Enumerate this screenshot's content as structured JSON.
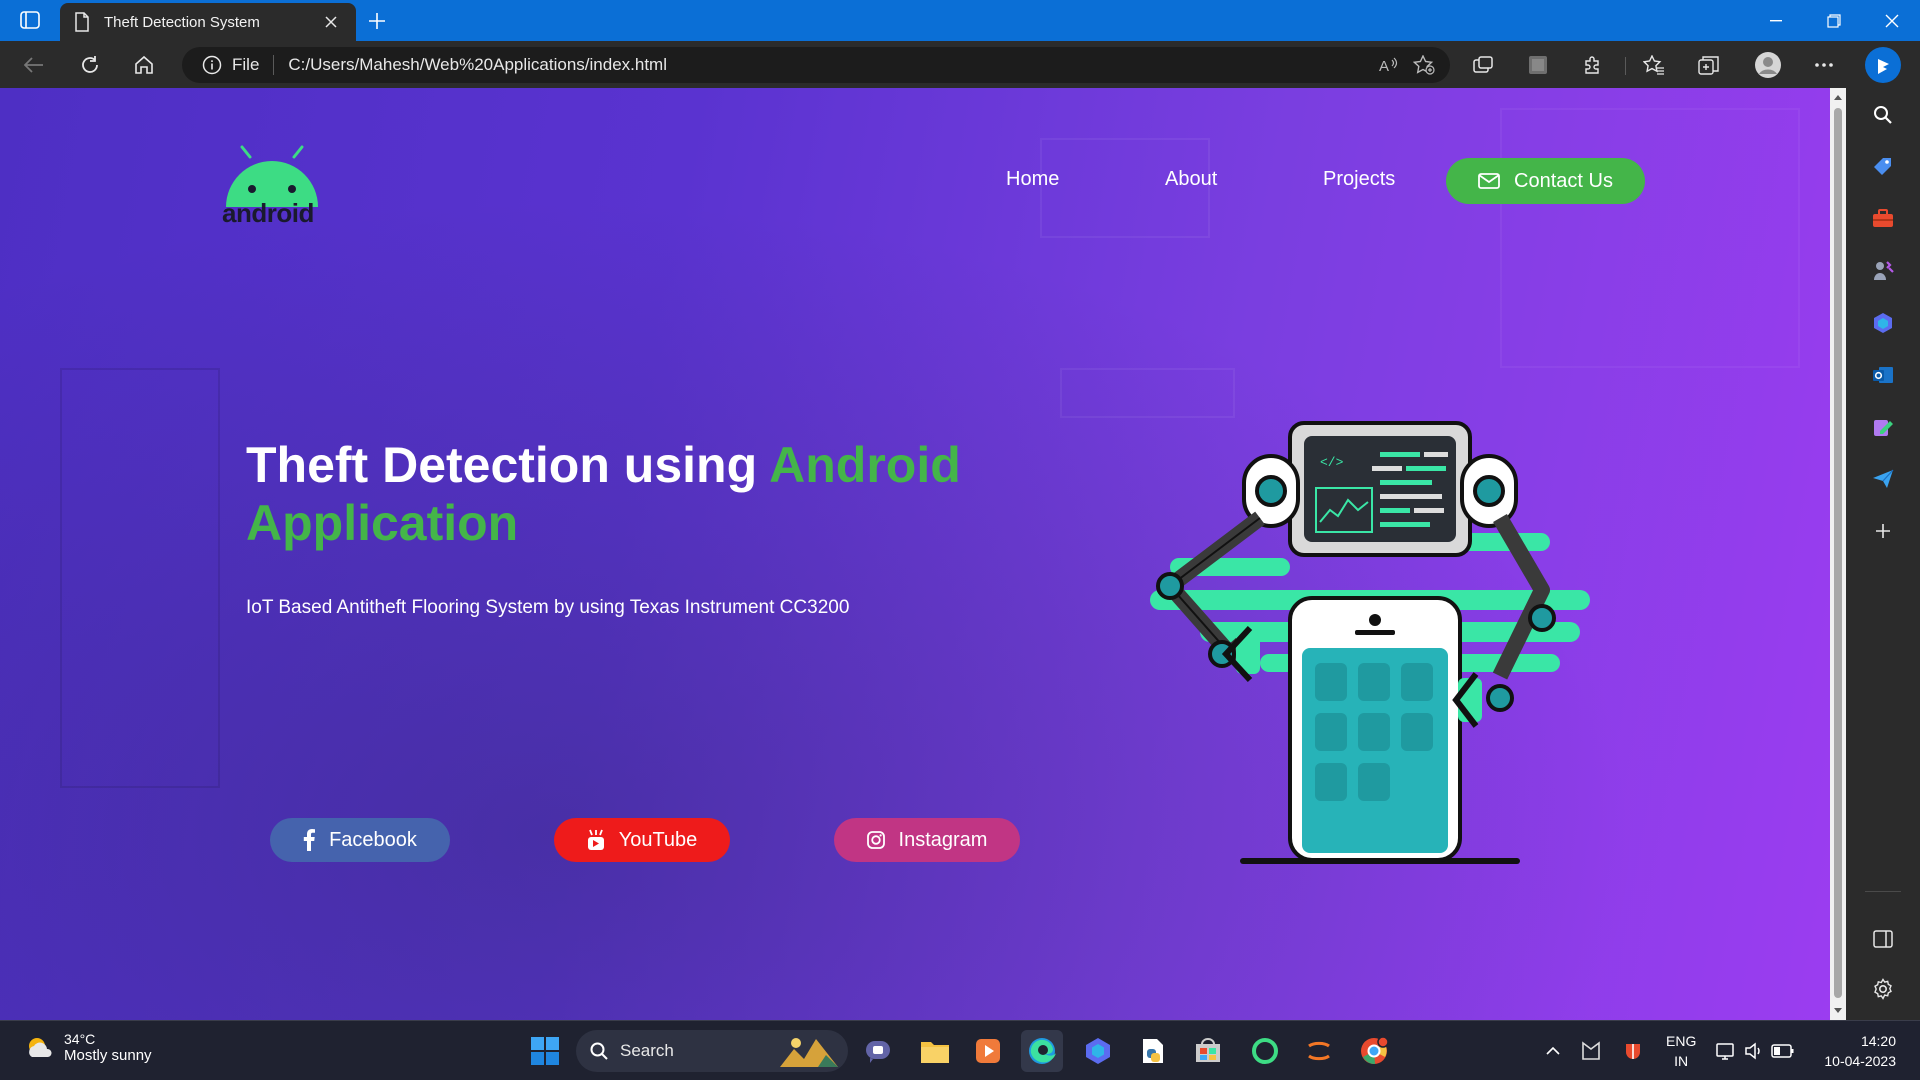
{
  "browser": {
    "tab_title": "Theft Detection System",
    "address_scheme": "File",
    "address_url": "C:/Users/Mahesh/Web%20Applications/index.html"
  },
  "page": {
    "logo_text": "android",
    "nav": [
      "Home",
      "About",
      "Projects"
    ],
    "contact_label": "Contact Us",
    "hero_title_white": "Theft Detection using",
    "hero_title_green": "Android Application",
    "hero_subtitle": "IoT Based Antitheft Flooring System by using Texas Instrument CC3200",
    "social": {
      "facebook": "Facebook",
      "youtube": "YouTube",
      "instagram": "Instagram"
    },
    "colors": {
      "accent_green": "#44b549",
      "facebook": "#4563ad",
      "youtube": "#ee1b1b",
      "instagram": "#c13584"
    }
  },
  "taskbar": {
    "weather_temp": "34°C",
    "weather_desc": "Mostly sunny",
    "search_label": "Search",
    "lang_line1": "ENG",
    "lang_line2": "IN",
    "time": "14:20",
    "date": "10-04-2023"
  }
}
